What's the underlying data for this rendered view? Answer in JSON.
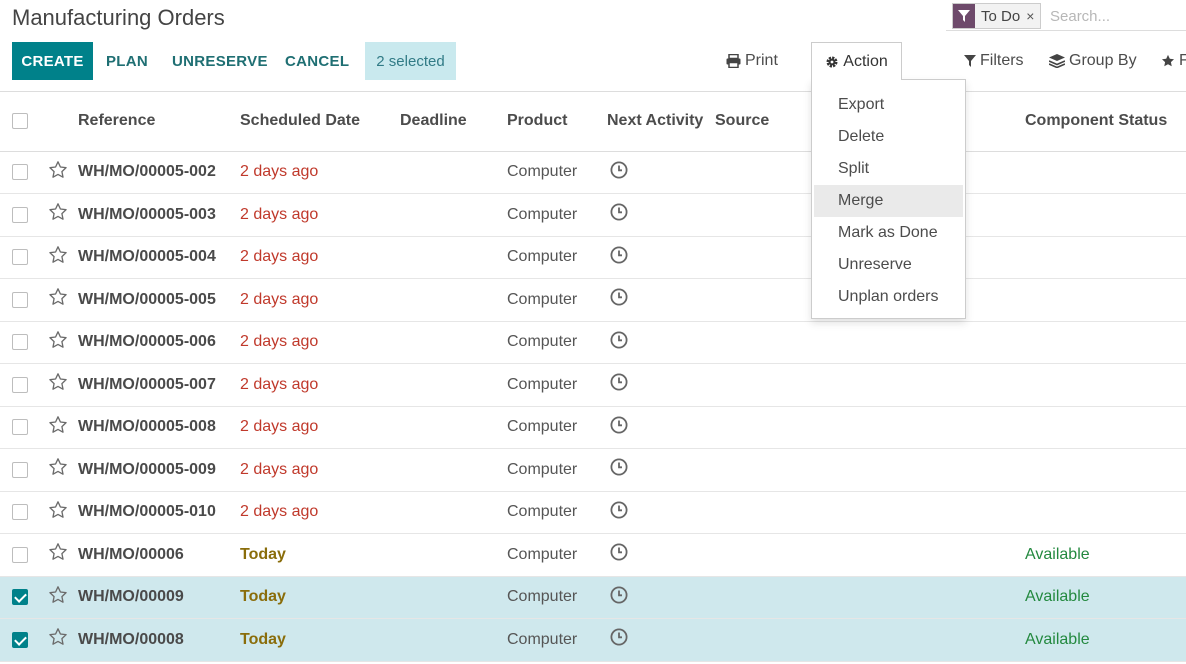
{
  "page": {
    "title": "Manufacturing Orders"
  },
  "search": {
    "facet_label": "To Do",
    "facet_close": "×",
    "placeholder": "Search..."
  },
  "toolbar": {
    "create": "CREATE",
    "plan": "PLAN",
    "unreserve": "UNRESERVE",
    "cancel": "CANCEL",
    "selected": "2 selected",
    "print": "Print",
    "action": "Action",
    "filters": "Filters",
    "group_by": "Group By",
    "favorites": "F"
  },
  "action_menu": [
    "Export",
    "Delete",
    "Split",
    "Merge",
    "Mark as Done",
    "Unreserve",
    "Unplan orders"
  ],
  "action_menu_highlighted": "Merge",
  "table": {
    "columns": {
      "reference": "Reference",
      "scheduled_date": "Scheduled Date",
      "deadline": "Deadline",
      "product": "Product",
      "next_activity": "Next Activity",
      "source": "Source",
      "component_status": "Component Status"
    },
    "rows": [
      {
        "ref": "WH/MO/00005-002",
        "date": "2 days ago",
        "product": "Computer",
        "status": "",
        "checked": false
      },
      {
        "ref": "WH/MO/00005-003",
        "date": "2 days ago",
        "product": "Computer",
        "status": "",
        "checked": false
      },
      {
        "ref": "WH/MO/00005-004",
        "date": "2 days ago",
        "product": "Computer",
        "status": "",
        "checked": false
      },
      {
        "ref": "WH/MO/00005-005",
        "date": "2 days ago",
        "product": "Computer",
        "status": "",
        "checked": false
      },
      {
        "ref": "WH/MO/00005-006",
        "date": "2 days ago",
        "product": "Computer",
        "status": "",
        "checked": false
      },
      {
        "ref": "WH/MO/00005-007",
        "date": "2 days ago",
        "product": "Computer",
        "status": "",
        "checked": false
      },
      {
        "ref": "WH/MO/00005-008",
        "date": "2 days ago",
        "product": "Computer",
        "status": "",
        "checked": false
      },
      {
        "ref": "WH/MO/00005-009",
        "date": "2 days ago",
        "product": "Computer",
        "status": "",
        "checked": false
      },
      {
        "ref": "WH/MO/00005-010",
        "date": "2 days ago",
        "product": "Computer",
        "status": "",
        "checked": false
      },
      {
        "ref": "WH/MO/00006",
        "date": "Today",
        "product": "Computer",
        "status": "Available",
        "checked": false
      },
      {
        "ref": "WH/MO/00009",
        "date": "Today",
        "product": "Computer",
        "status": "Available",
        "checked": true
      },
      {
        "ref": "WH/MO/00008",
        "date": "Today",
        "product": "Computer",
        "status": "Available",
        "checked": true
      }
    ]
  },
  "colors": {
    "primary": "#00818a",
    "late": "#c0392b",
    "today": "#8a6d0b",
    "available": "#23893f",
    "selected_row": "#cfe8ed"
  }
}
